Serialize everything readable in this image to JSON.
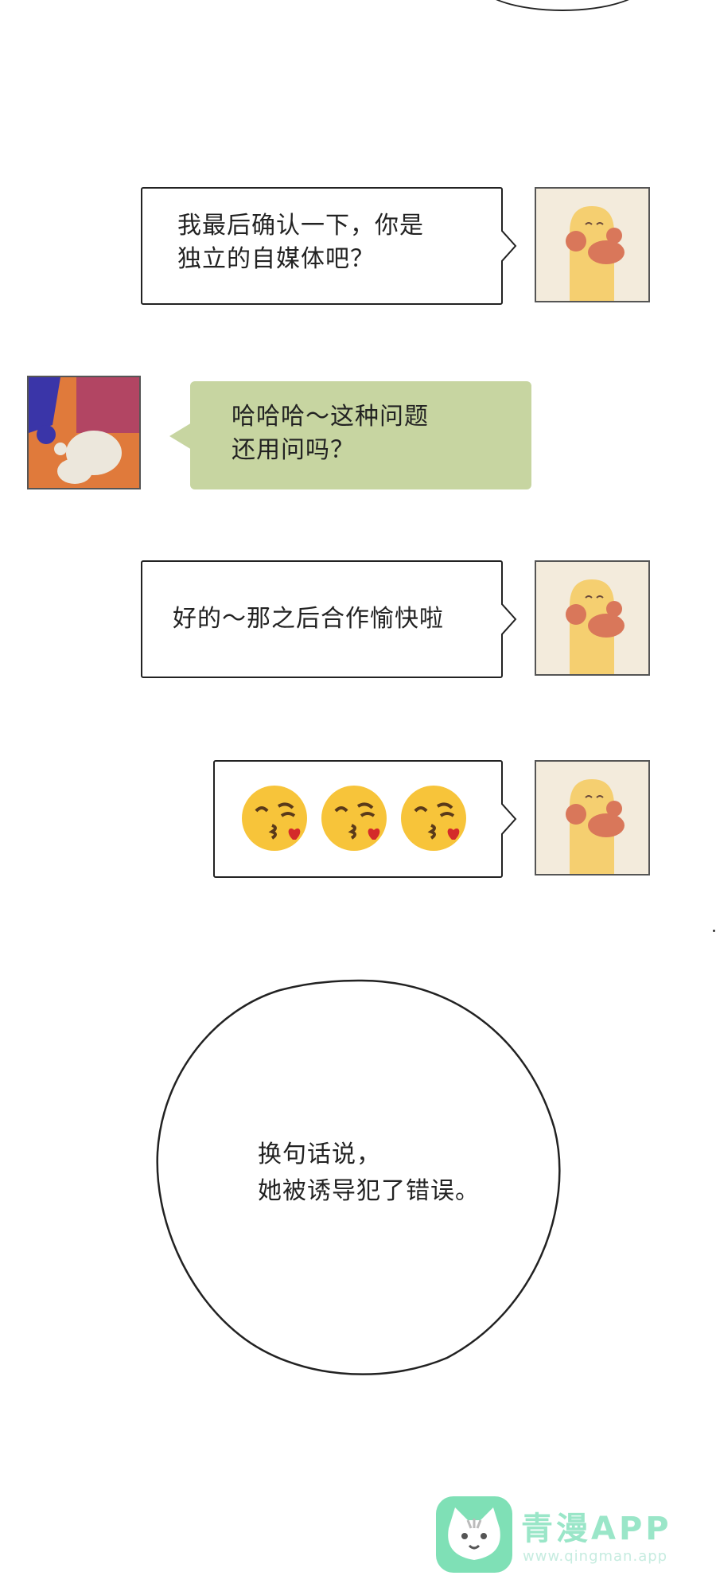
{
  "messages": [
    {
      "text_line1": "我最后确认一下，你是",
      "text_line2": "独立的自媒体吧？"
    },
    {
      "text_line1": "哈哈哈～这种问题",
      "text_line2": "还用问吗？"
    },
    {
      "text": "好的～那之后合作愉快啦"
    },
    {
      "emojis": [
        "kissing-face-with-heart-icon",
        "kissing-face-with-heart-icon",
        "kissing-face-with-heart-icon"
      ]
    }
  ],
  "narration": {
    "line1": "换句话说，",
    "line2": "她被诱导犯了错误。"
  },
  "watermark": {
    "title": "青漫APP",
    "url": "www.qingman.app"
  },
  "colors": {
    "green_bubble": "#c7d5a1",
    "avatar_bg": "#f3ebdc",
    "avatar_figure": "#f5cf70",
    "avatar_cheek": "#d9775a"
  }
}
